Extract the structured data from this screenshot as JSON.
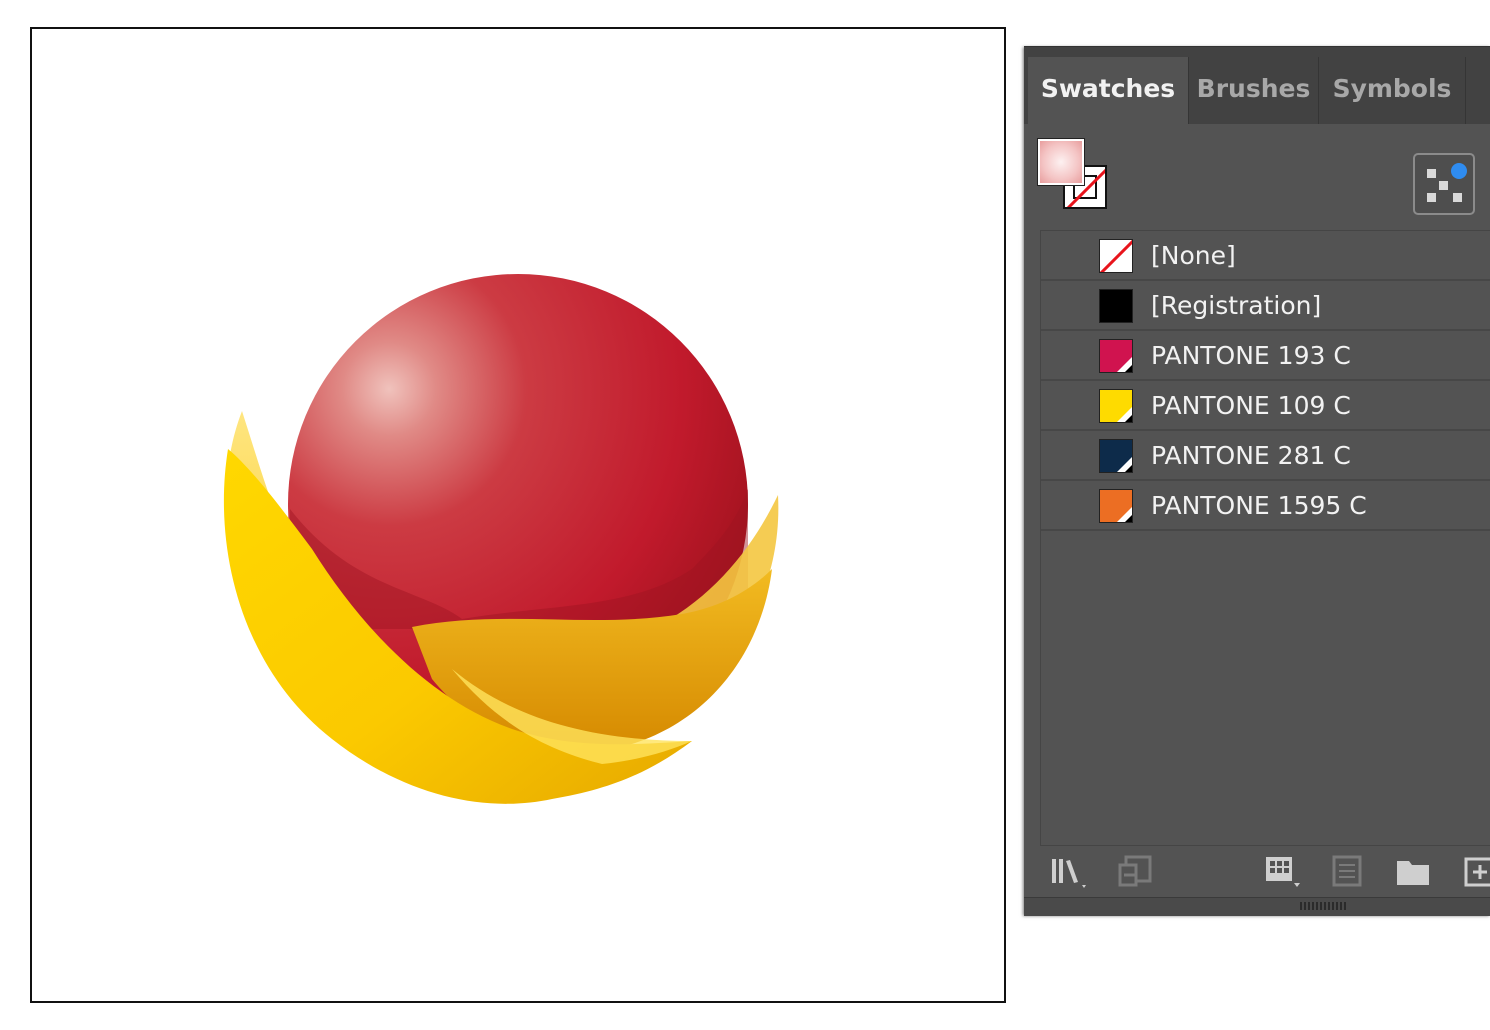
{
  "panel": {
    "tabs": [
      {
        "label": "Swatches",
        "active": true
      },
      {
        "label": "Brushes",
        "active": false
      },
      {
        "label": "Symbols",
        "active": false
      }
    ]
  },
  "fill_stroke": {
    "fill_icon": "fill-swatch-icon",
    "stroke_icon": "stroke-none-icon"
  },
  "swatches": [
    {
      "label": "[None]",
      "type": "none"
    },
    {
      "label": "[Registration]",
      "type": "registration",
      "color": "#000000"
    },
    {
      "label": "PANTONE 193 C",
      "type": "spot",
      "color": "#d0134f"
    },
    {
      "label": "PANTONE 109 C",
      "type": "spot",
      "color": "#fedb00"
    },
    {
      "label": "PANTONE 281 C",
      "type": "spot",
      "color": "#0d2b4a"
    },
    {
      "label": "PANTONE 1595 C",
      "type": "spot",
      "color": "#ec6e23"
    }
  ],
  "toolbar_icons": [
    "swatch-libraries-icon",
    "place-swatches-icon",
    "swatch-kinds-icon",
    "swatch-options-icon",
    "new-color-group-icon",
    "new-swatch-icon"
  ],
  "colors": {
    "panel_bg": "#535353",
    "tabbar_bg": "#424242",
    "sphere_red": "#c8202f",
    "wave_yellow": "#f6c200",
    "wave_orange": "#e09a00",
    "selection_blue": "#2f8cf0"
  }
}
